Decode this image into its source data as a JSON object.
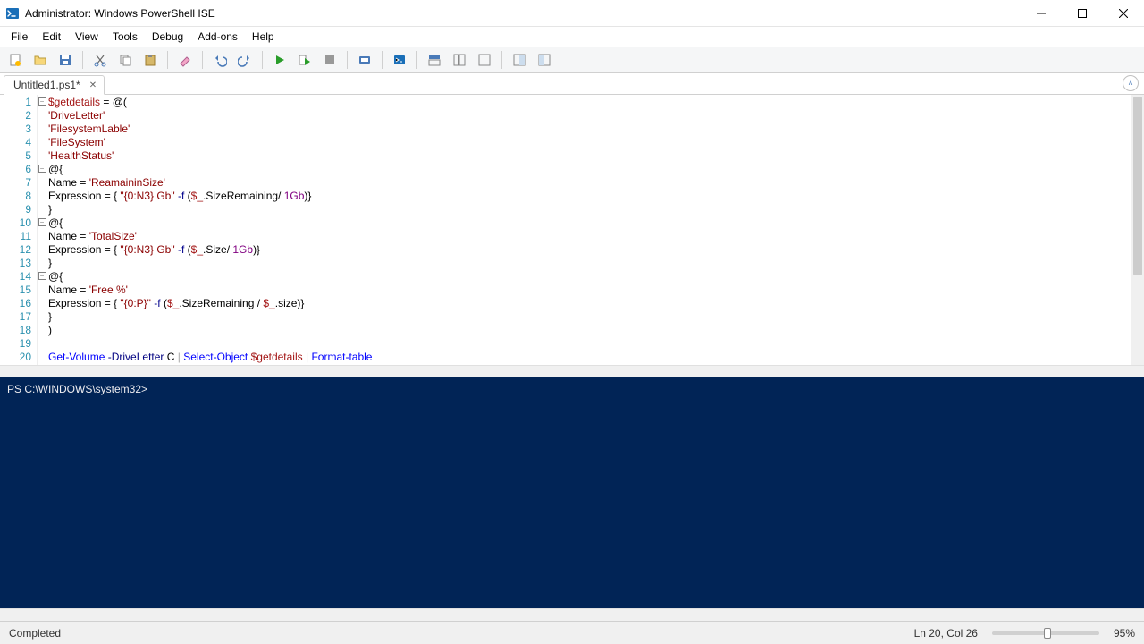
{
  "window": {
    "title": "Administrator: Windows PowerShell ISE"
  },
  "menu": {
    "items": [
      "File",
      "Edit",
      "View",
      "Tools",
      "Debug",
      "Add-ons",
      "Help"
    ]
  },
  "tabs": {
    "items": [
      {
        "label": "Untitled1.ps1*"
      }
    ]
  },
  "editor": {
    "lines": [
      {
        "n": 1,
        "fold": "box",
        "tokens": [
          [
            "var",
            "$getdetails"
          ],
          [
            "",
            ""
          ],
          [
            "",
            " = @("
          ]
        ]
      },
      {
        "n": 2,
        "fold": "",
        "tokens": [
          [
            "str",
            "'DriveLetter'"
          ]
        ]
      },
      {
        "n": 3,
        "fold": "",
        "tokens": [
          [
            "str",
            "'FilesystemLable'"
          ]
        ]
      },
      {
        "n": 4,
        "fold": "",
        "tokens": [
          [
            "str",
            "'FileSystem'"
          ]
        ]
      },
      {
        "n": 5,
        "fold": "",
        "tokens": [
          [
            "str",
            "'HealthStatus'"
          ]
        ]
      },
      {
        "n": 6,
        "fold": "box",
        "tokens": [
          [
            "",
            "@{"
          ]
        ]
      },
      {
        "n": 7,
        "fold": "",
        "tokens": [
          [
            "",
            "Name = "
          ],
          [
            "str",
            "'ReamaininSize'"
          ]
        ]
      },
      {
        "n": 8,
        "fold": "",
        "tokens": [
          [
            "",
            "Expression = { "
          ],
          [
            "str",
            "\"{0:N3} Gb\""
          ],
          [
            "",
            " "
          ],
          [
            "key",
            "-f"
          ],
          [
            "",
            " ("
          ],
          [
            "var",
            "$_"
          ],
          [
            "",
            ".SizeRemaining/ "
          ],
          [
            "num",
            "1Gb"
          ],
          [
            "",
            ")}"
          ]
        ]
      },
      {
        "n": 9,
        "fold": "",
        "tokens": [
          [
            "",
            "}"
          ]
        ]
      },
      {
        "n": 10,
        "fold": "box",
        "tokens": [
          [
            "",
            "@{"
          ]
        ]
      },
      {
        "n": 11,
        "fold": "",
        "tokens": [
          [
            "",
            "Name = "
          ],
          [
            "str",
            "'TotalSize'"
          ]
        ]
      },
      {
        "n": 12,
        "fold": "",
        "tokens": [
          [
            "",
            "Expression = { "
          ],
          [
            "str",
            "\"{0:N3} Gb\""
          ],
          [
            "",
            " "
          ],
          [
            "key",
            "-f"
          ],
          [
            "",
            " ("
          ],
          [
            "var",
            "$_"
          ],
          [
            "",
            ".Size/ "
          ],
          [
            "num",
            "1Gb"
          ],
          [
            "",
            ")}"
          ]
        ]
      },
      {
        "n": 13,
        "fold": "",
        "tokens": [
          [
            "",
            "}"
          ]
        ]
      },
      {
        "n": 14,
        "fold": "box",
        "tokens": [
          [
            "",
            "@{"
          ]
        ]
      },
      {
        "n": 15,
        "fold": "",
        "tokens": [
          [
            "",
            "Name = "
          ],
          [
            "str",
            "'Free %'"
          ]
        ]
      },
      {
        "n": 16,
        "fold": "",
        "tokens": [
          [
            "",
            "Expression = { "
          ],
          [
            "str",
            "\"{0:P}\""
          ],
          [
            "",
            " "
          ],
          [
            "key",
            "-f"
          ],
          [
            "",
            " ("
          ],
          [
            "var",
            "$_"
          ],
          [
            "",
            ".SizeRemaining / "
          ],
          [
            "var",
            "$_"
          ],
          [
            "",
            ".size)}"
          ]
        ]
      },
      {
        "n": 17,
        "fold": "",
        "tokens": [
          [
            "",
            "}"
          ]
        ]
      },
      {
        "n": 18,
        "fold": "",
        "tokens": [
          [
            "",
            ")"
          ]
        ]
      },
      {
        "n": 19,
        "fold": "",
        "tokens": [
          [
            "",
            ""
          ]
        ]
      },
      {
        "n": 20,
        "fold": "",
        "tokens": [
          [
            "cmd",
            "Get-Volume"
          ],
          [
            "",
            " "
          ],
          [
            "param",
            "-DriveLetter"
          ],
          [
            "",
            " C "
          ],
          [
            "pipe",
            "|"
          ],
          [
            "",
            " "
          ],
          [
            "cmd",
            "Select-Object"
          ],
          [
            "",
            " "
          ],
          [
            "var",
            "$getdetails"
          ],
          [
            "",
            " "
          ],
          [
            "pipe",
            "|"
          ],
          [
            "",
            " "
          ],
          [
            "cmd",
            "Format-table"
          ]
        ]
      }
    ]
  },
  "console": {
    "prompt": "PS C:\\WINDOWS\\system32> "
  },
  "status": {
    "left": "Completed",
    "position": "Ln 20, Col 26",
    "zoom": "95%"
  }
}
